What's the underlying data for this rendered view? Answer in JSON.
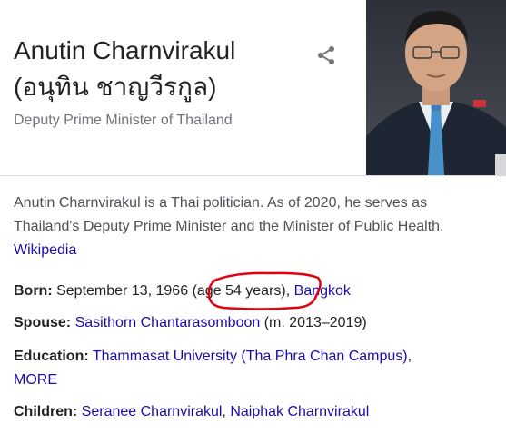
{
  "entity": {
    "name": "Anutin Charnvirakul",
    "native_name": "(อนุทิน ชาญวีรกูล)",
    "subtitle": "Deputy Prime Minister of Thailand"
  },
  "description": {
    "text": "Anutin Charnvirakul is a Thai politician. As of 2020, he serves as Thailand's Deputy Prime Minister and the Minister of Public Health.",
    "source_link": "Wikipedia"
  },
  "facts": {
    "born": {
      "label": "Born:",
      "date": "September 13, 1966",
      "age": "(age 54 years)",
      "separator": ",",
      "place_link": "Bangkok"
    },
    "spouse": {
      "label": "Spouse:",
      "name_link": "Sasithorn Chantarasomboon",
      "detail": "(m. 2013–2019)"
    },
    "education": {
      "label": "Education:",
      "school_link": "Thammasat University (Tha Phra Chan Campus)",
      "separator": ",",
      "more_link": "MORE"
    },
    "children": {
      "label": "Children:",
      "child1_link": "Seranee Charnvirakul",
      "separator": ",",
      "child2_link": "Naiphak Charnvirakul"
    }
  },
  "icons": {
    "share": "share-icon"
  },
  "colors": {
    "link": "#1a0dab",
    "text": "#222222",
    "muted": "#70757a",
    "annotation": "#e3000f"
  }
}
